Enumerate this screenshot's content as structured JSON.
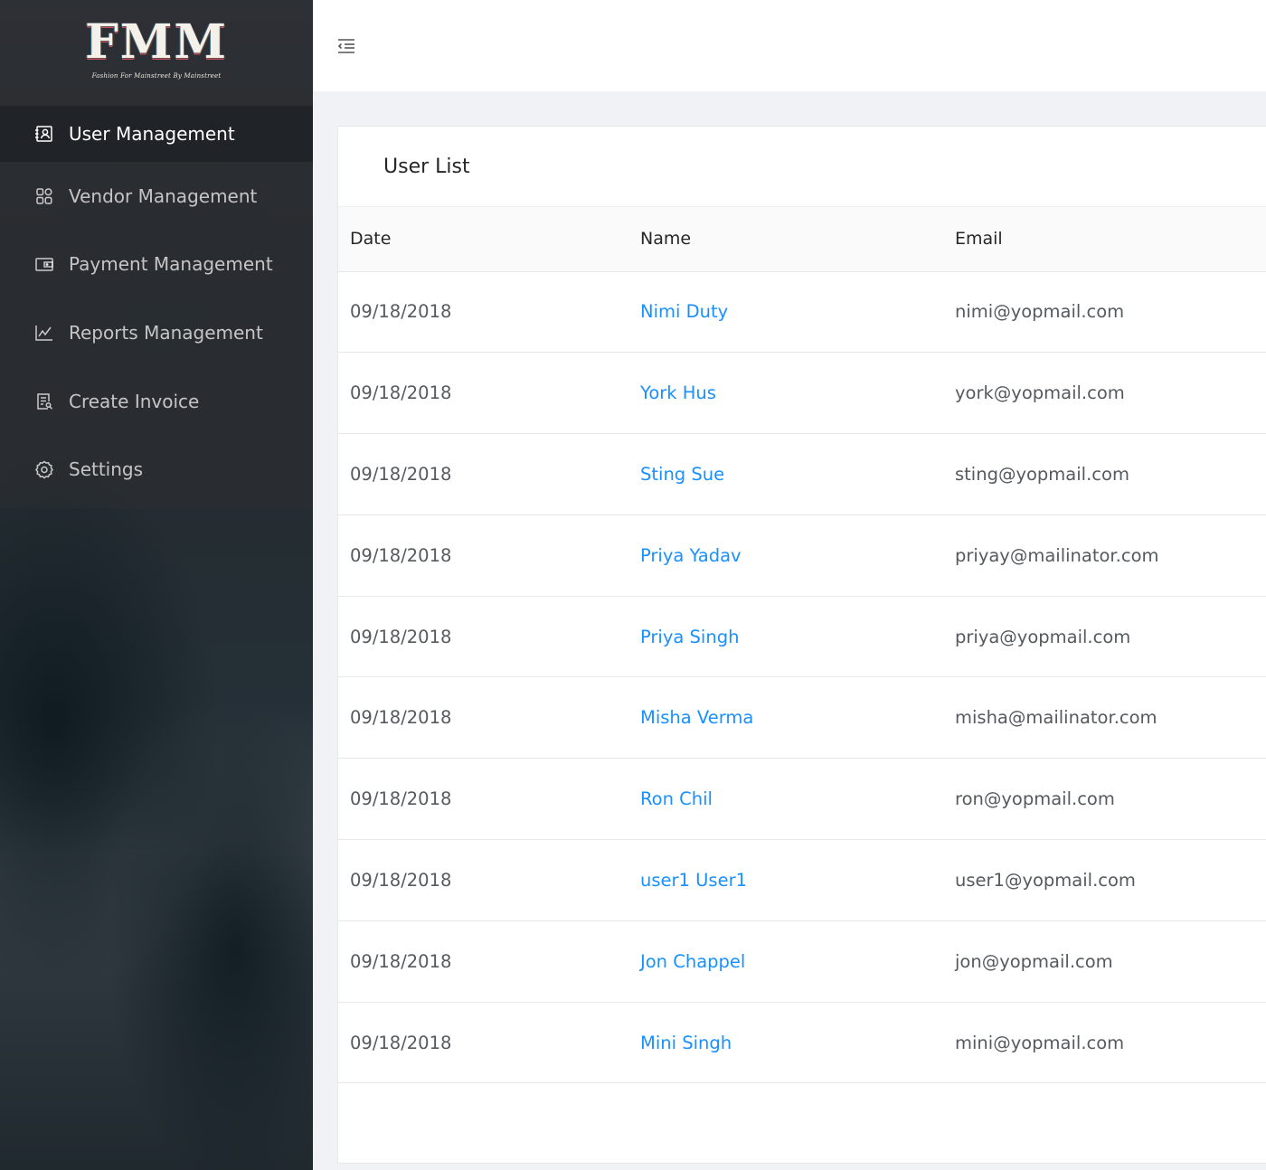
{
  "logo": {
    "letters": "FMM",
    "tagline": "Fashion For Mainstreet By Mainstreet"
  },
  "sidebar": {
    "items": [
      {
        "label": "User Management",
        "icon": "user-card-icon",
        "active": true
      },
      {
        "label": "Vendor Management",
        "icon": "apps-icon",
        "active": false
      },
      {
        "label": "Payment Management",
        "icon": "wallet-icon",
        "active": false
      },
      {
        "label": "Reports Management",
        "icon": "line-chart-icon",
        "active": false
      },
      {
        "label": "Create Invoice",
        "icon": "invoice-icon",
        "active": false
      },
      {
        "label": "Settings",
        "icon": "gear-icon",
        "active": false
      }
    ]
  },
  "header": {
    "toggle_icon": "menu-fold-icon"
  },
  "card": {
    "title": "User List",
    "columns": [
      "Date",
      "Name",
      "Email"
    ],
    "rows": [
      {
        "date": "09/18/2018",
        "name": "Nimi Duty",
        "email": "nimi@yopmail.com"
      },
      {
        "date": "09/18/2018",
        "name": "York Hus",
        "email": "york@yopmail.com"
      },
      {
        "date": "09/18/2018",
        "name": "Sting Sue",
        "email": "sting@yopmail.com"
      },
      {
        "date": "09/18/2018",
        "name": "Priya Yadav",
        "email": "priyay@mailinator.com"
      },
      {
        "date": "09/18/2018",
        "name": "Priya Singh",
        "email": "priya@yopmail.com"
      },
      {
        "date": "09/18/2018",
        "name": "Misha Verma",
        "email": "misha@mailinator.com"
      },
      {
        "date": "09/18/2018",
        "name": "Ron Chil",
        "email": "ron@yopmail.com"
      },
      {
        "date": "09/18/2018",
        "name": "user1 User1",
        "email": "user1@yopmail.com"
      },
      {
        "date": "09/18/2018",
        "name": "Jon Chappel",
        "email": "jon@yopmail.com"
      },
      {
        "date": "09/18/2018",
        "name": "Mini Singh",
        "email": "mini@yopmail.com"
      }
    ]
  },
  "colors": {
    "link": "#1890ff",
    "page_bg": "#f0f2f5",
    "sidebar_dark": "#2c3034"
  }
}
